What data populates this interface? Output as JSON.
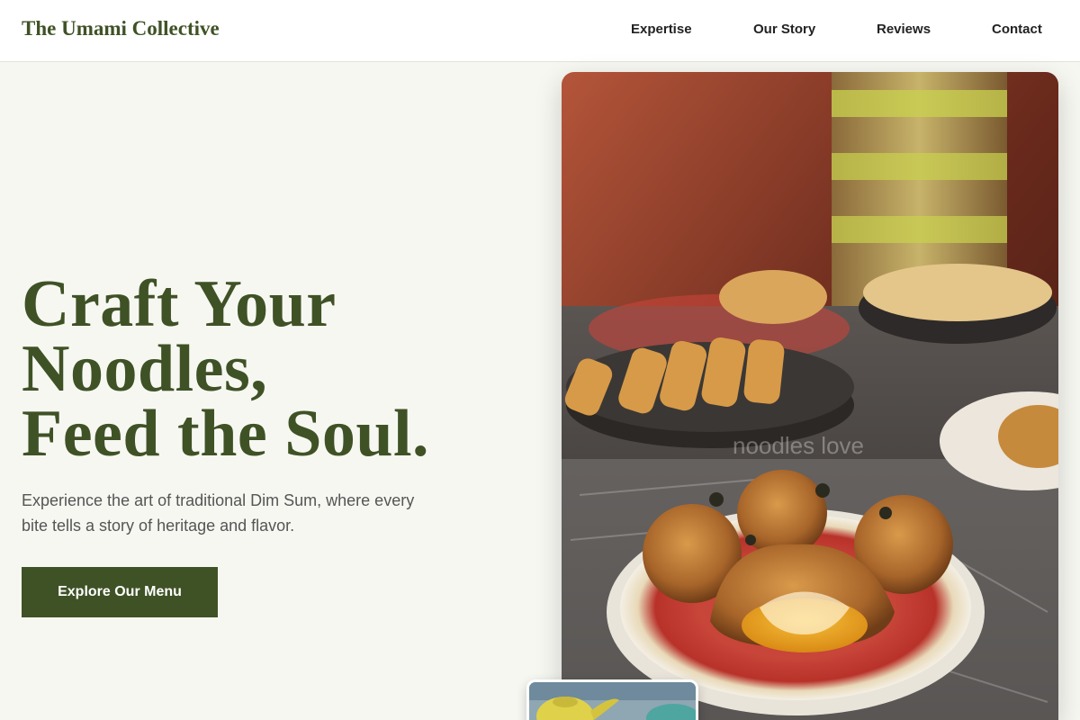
{
  "header": {
    "brand": "The Umami Collective",
    "nav": [
      "Expertise",
      "Our Story",
      "Reviews",
      "Contact"
    ]
  },
  "hero": {
    "title_lines": [
      "Craft Your",
      "Noodles,",
      "Feed the Soul."
    ],
    "subtitle": "Experience the art of traditional Dim Sum, where every bite tells a story of heritage and flavor.",
    "cta_label": "Explore Our Menu"
  },
  "image": {
    "watermark": "noodles love"
  },
  "colors": {
    "accent": "#3f5226",
    "background": "#f7f7f2",
    "header_bg": "#ffffff"
  }
}
